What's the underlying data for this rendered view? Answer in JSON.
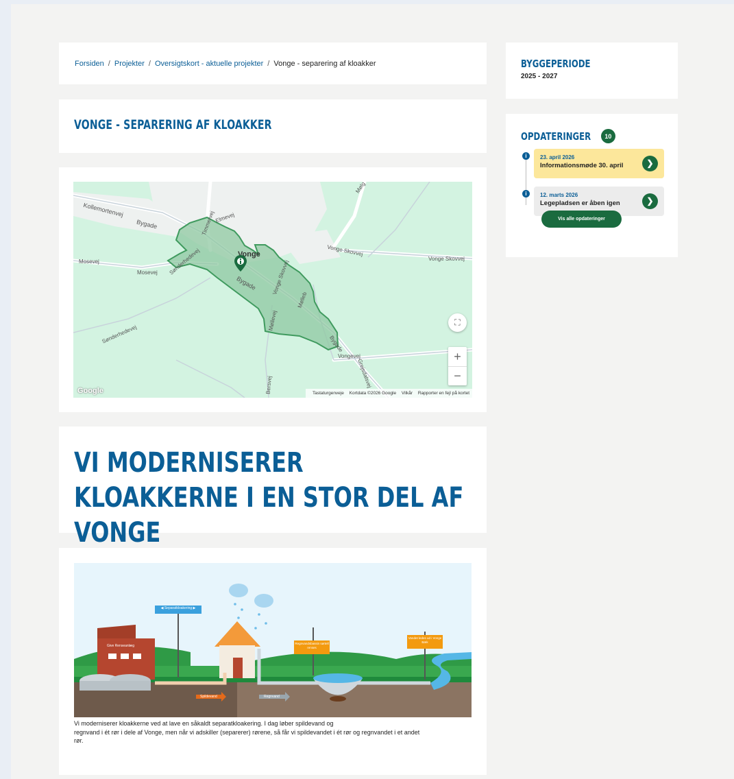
{
  "breadcrumb": {
    "items": [
      "Forsiden",
      "Projekter",
      "Oversigtskort - aktuelle projekter"
    ],
    "current": "Vonge - separering af kloakker",
    "separator": "/"
  },
  "page_title": "VONGE - SEPARERING AF KLOAKKER",
  "map": {
    "labels": {
      "kollemortenvej": "Kollemortenvej",
      "bygade_1": "Bygade",
      "bygade_2": "Bygade",
      "bygade_3": "Bygade",
      "timmervej": "Timmervej",
      "elmevej": "Elmevej",
      "vonge": "Vonge",
      "vonge_skovvej_1": "Vonge Skovvej",
      "vonge_skovvej_2": "Vonge Skovvej",
      "vonge_skovvej_3": "Vonge Skovvej",
      "mosevej_1": "Mosevej",
      "mosevej_2": "Mosevej",
      "sonderhedevej_1": "Sønderhedevej",
      "sonderhedevej_2": "Sønderhedevej",
      "mollevej": "Møllevej",
      "vongevej_1": "Vongevej",
      "vongevej_2": "Vo",
      "grejsdalsvej": "Grejsdalsvej",
      "maelgarden": "Mølg",
      "bersvej": "Bersvej",
      "mosegaardsvej": "Mølleb"
    },
    "footer": [
      "Tastaturgenveje",
      "Kortdata ©2026 Google",
      "Vilkår",
      "Rapporter en fejl på kortet"
    ],
    "logo": "Google",
    "zoom_in": "+",
    "zoom_out": "−"
  },
  "intro_heading": "VI MODERNISERER KLOAKKERNE I EN STOR DEL AF VONGE",
  "illustration": {
    "sign_top": "◀ Separatkloakering ▶",
    "factory_label": "Give Renseanlæg",
    "sign_rain_basin": "Regnvandsbassin sørtell renses",
    "sign_lake": "Vandet ledes ud i Vonge Bæk",
    "arrow_waste": "Spildevand",
    "arrow_rain": "Regnvand"
  },
  "caption": {
    "line1": "Vi moderniserer kloakkerne ved at lave en såkaldt separatkloakering. I dag løber spildevand og",
    "line2": "regnvand i ét rør i dele af Vonge, men når vi adskiller (separerer) rørene, så får vi spildevandet i ét rør og regnvandet i et andet",
    "line3": "rør."
  },
  "build_period": {
    "heading": "BYGGEPERIODE",
    "years": "2025 - 2027"
  },
  "updates": {
    "heading": "OPDATERINGER",
    "count": "10",
    "items": [
      {
        "date": "23. april 2026",
        "title": "Informationsmøde 30. april",
        "color": "#fce79b"
      },
      {
        "date": "12. marts 2026",
        "title": "Legepladsen er åben igen",
        "color": "#ececec"
      }
    ],
    "all_button": "Vis alle opdateringer"
  },
  "colors": {
    "brand_blue": "#0b5e96",
    "brand_green": "#1a6b3f",
    "highlight_yellow": "#fce79b",
    "map_green": "#d3f3e1",
    "area_green": "#7ebf95"
  }
}
